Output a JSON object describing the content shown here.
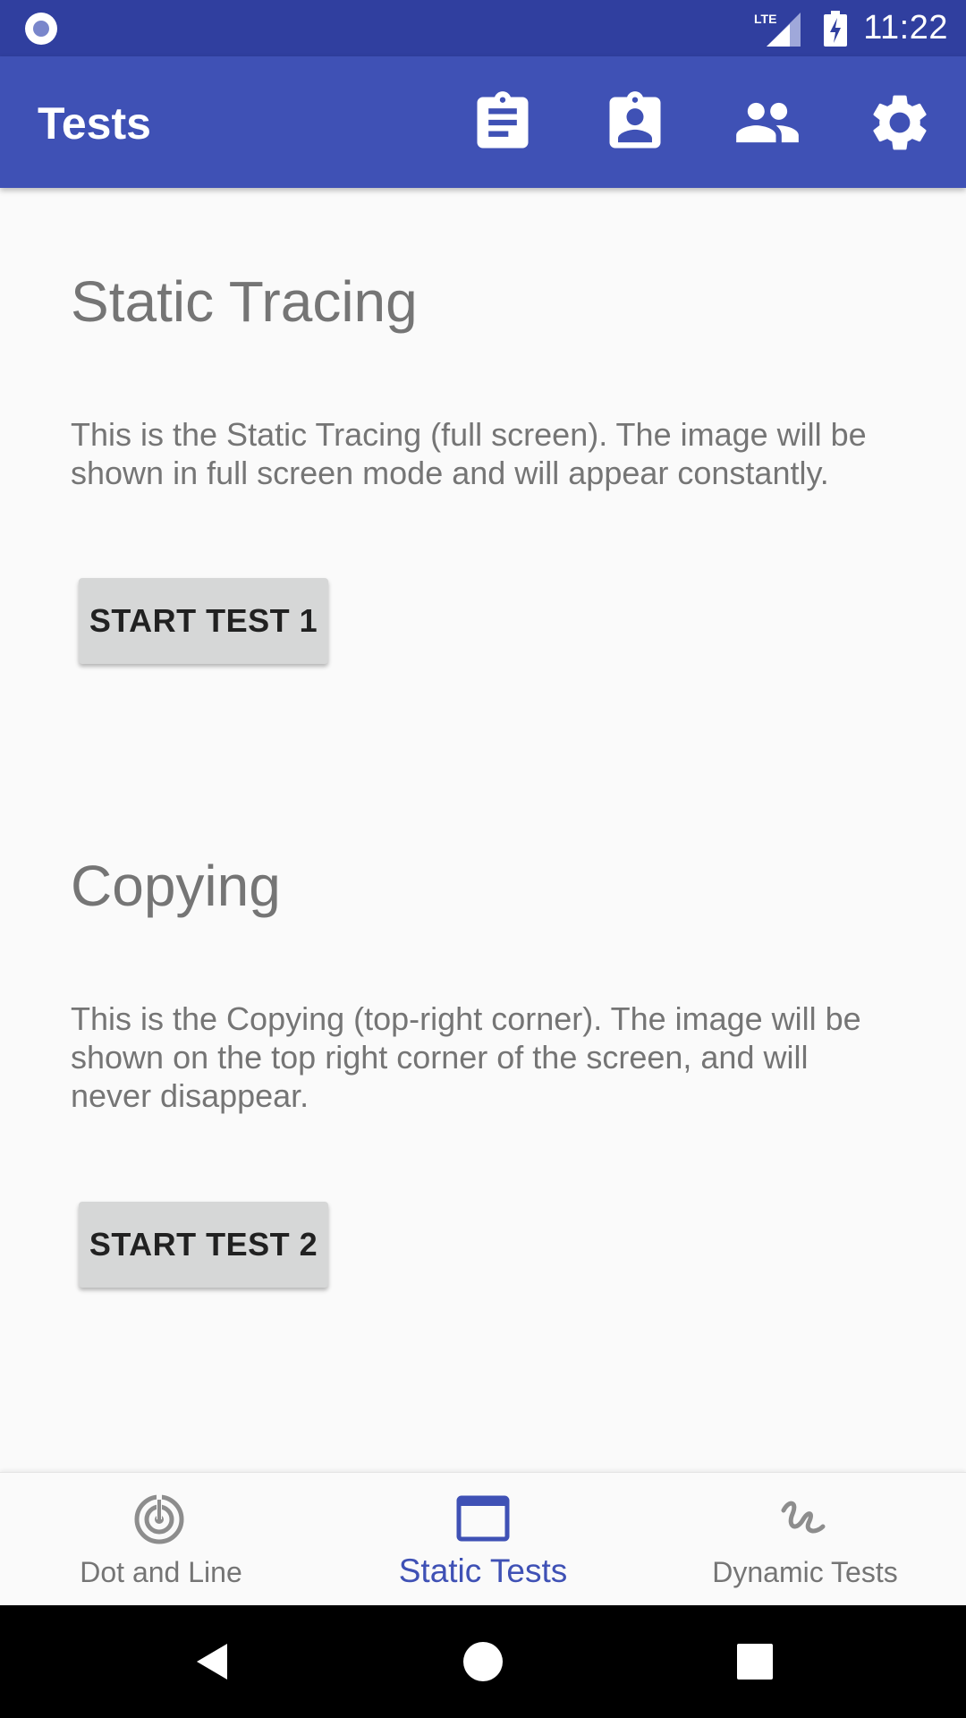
{
  "status_bar": {
    "time": "11:22",
    "network": "LTE",
    "icons": [
      "notification-circle-icon",
      "lte-signal-icon",
      "battery-charging-icon"
    ]
  },
  "app_bar": {
    "title": "Tests",
    "actions": [
      {
        "name": "clipboard-list-icon"
      },
      {
        "name": "contact-clipboard-icon"
      },
      {
        "name": "people-icon"
      },
      {
        "name": "settings-gear-icon"
      }
    ]
  },
  "sections": [
    {
      "title": "Static Tracing",
      "description": "This is the Static Tracing (full screen). The image will be shown in full screen mode and will appear constantly.",
      "button_label": "START TEST 1"
    },
    {
      "title": "Copying",
      "description": "This is the Copying (top-right corner). The image will be shown on the top right corner of the screen, and will never disappear.",
      "button_label": "START TEST 2"
    }
  ],
  "bottom_nav": {
    "items": [
      {
        "label": "Dot and Line",
        "icon": "target-radar-icon",
        "active": false
      },
      {
        "label": "Static Tests",
        "icon": "window-icon",
        "active": true
      },
      {
        "label": "Dynamic Tests",
        "icon": "squiggle-gesture-icon",
        "active": false
      }
    ]
  },
  "colors": {
    "status_bar": "#303f9f",
    "primary": "#3f51b5",
    "background": "#fafafa",
    "button": "#d6d7d7",
    "text_secondary": "#757575",
    "nav_inactive": "#757575"
  }
}
